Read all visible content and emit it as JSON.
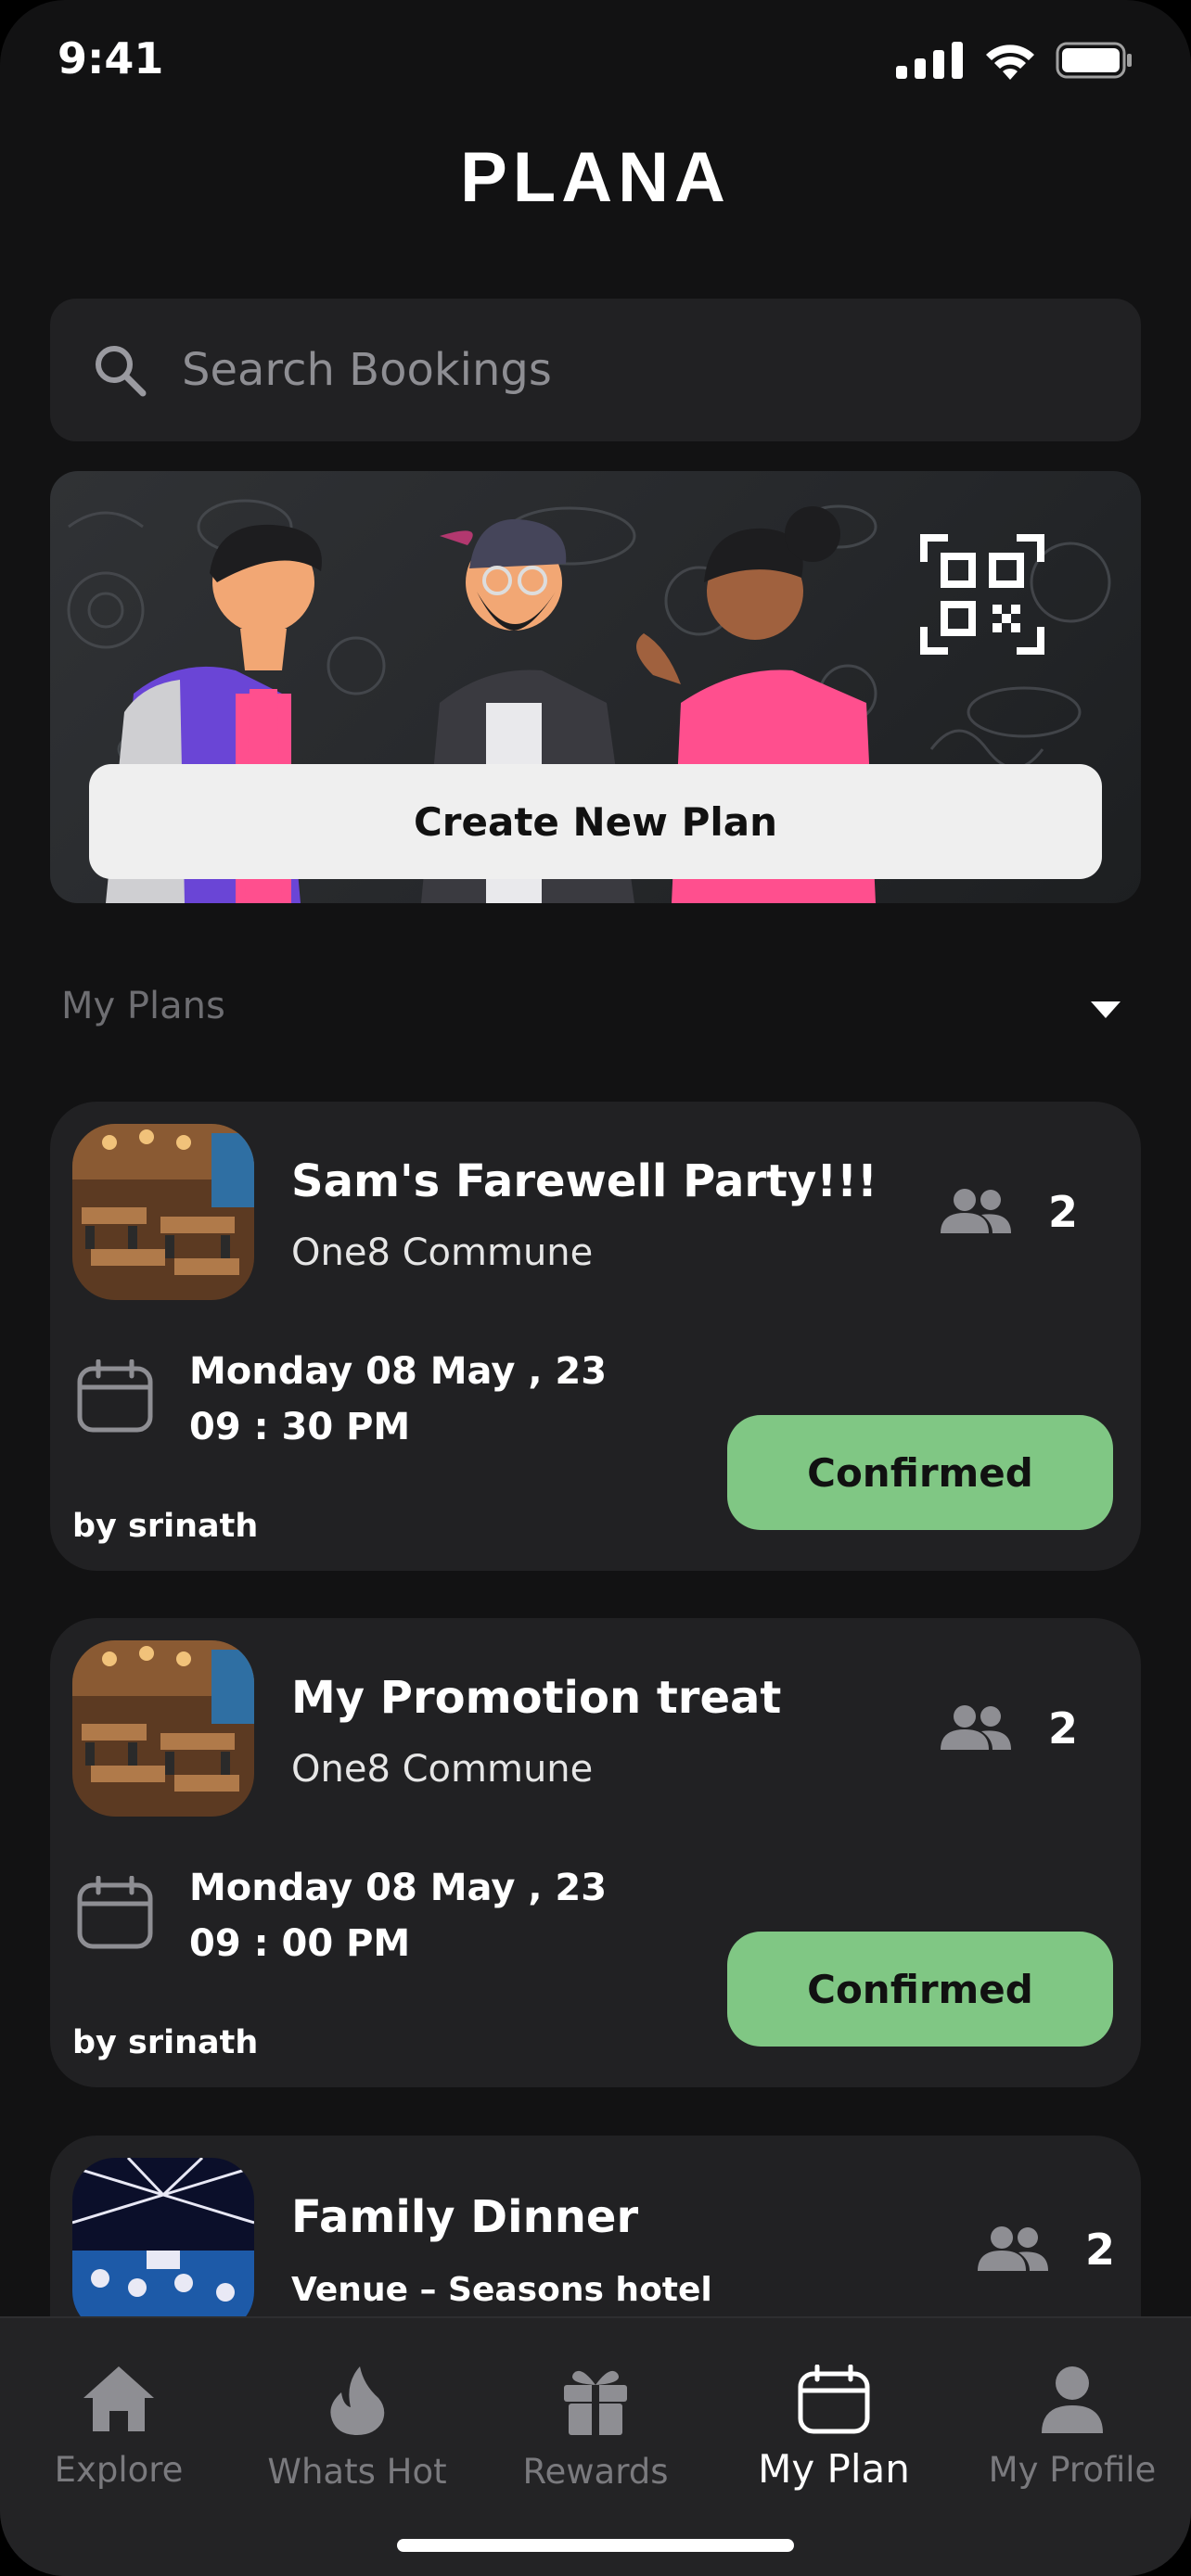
{
  "status_bar": {
    "time": "9:41"
  },
  "app": {
    "logo_text": "PLANA"
  },
  "search": {
    "placeholder": "Search Bookings"
  },
  "banner": {
    "create_button_label": "Create New Plan"
  },
  "section": {
    "title": "My Plans"
  },
  "plans": [
    {
      "title": "Sam's Farewell Party!!!",
      "venue": "One8 Commune",
      "people_count": "2",
      "date": "Monday 08 May , 23",
      "time": "09 : 30  PM",
      "by": "by srinath",
      "status": "Confirmed"
    },
    {
      "title": "My Promotion treat",
      "venue": "One8 Commune",
      "people_count": "2",
      "date": "Monday 08 May , 23",
      "time": "09 : 00  PM",
      "by": "by srinath",
      "status": "Confirmed"
    },
    {
      "title": "Family Dinner",
      "venue": "Venue – Seasons hotel",
      "people_count": "2"
    }
  ],
  "tabs": [
    {
      "label": "Explore",
      "icon": "home-icon"
    },
    {
      "label": "Whats Hot",
      "icon": "flame-icon"
    },
    {
      "label": "Rewards",
      "icon": "gift-icon"
    },
    {
      "label": "My Plan",
      "icon": "calendar-icon",
      "active": true
    },
    {
      "label": "My Profile",
      "icon": "person-icon"
    }
  ],
  "colors": {
    "background": "#121213",
    "card": "#212123",
    "confirmed": "#80c784",
    "muted_text": "#7a7a7e"
  }
}
